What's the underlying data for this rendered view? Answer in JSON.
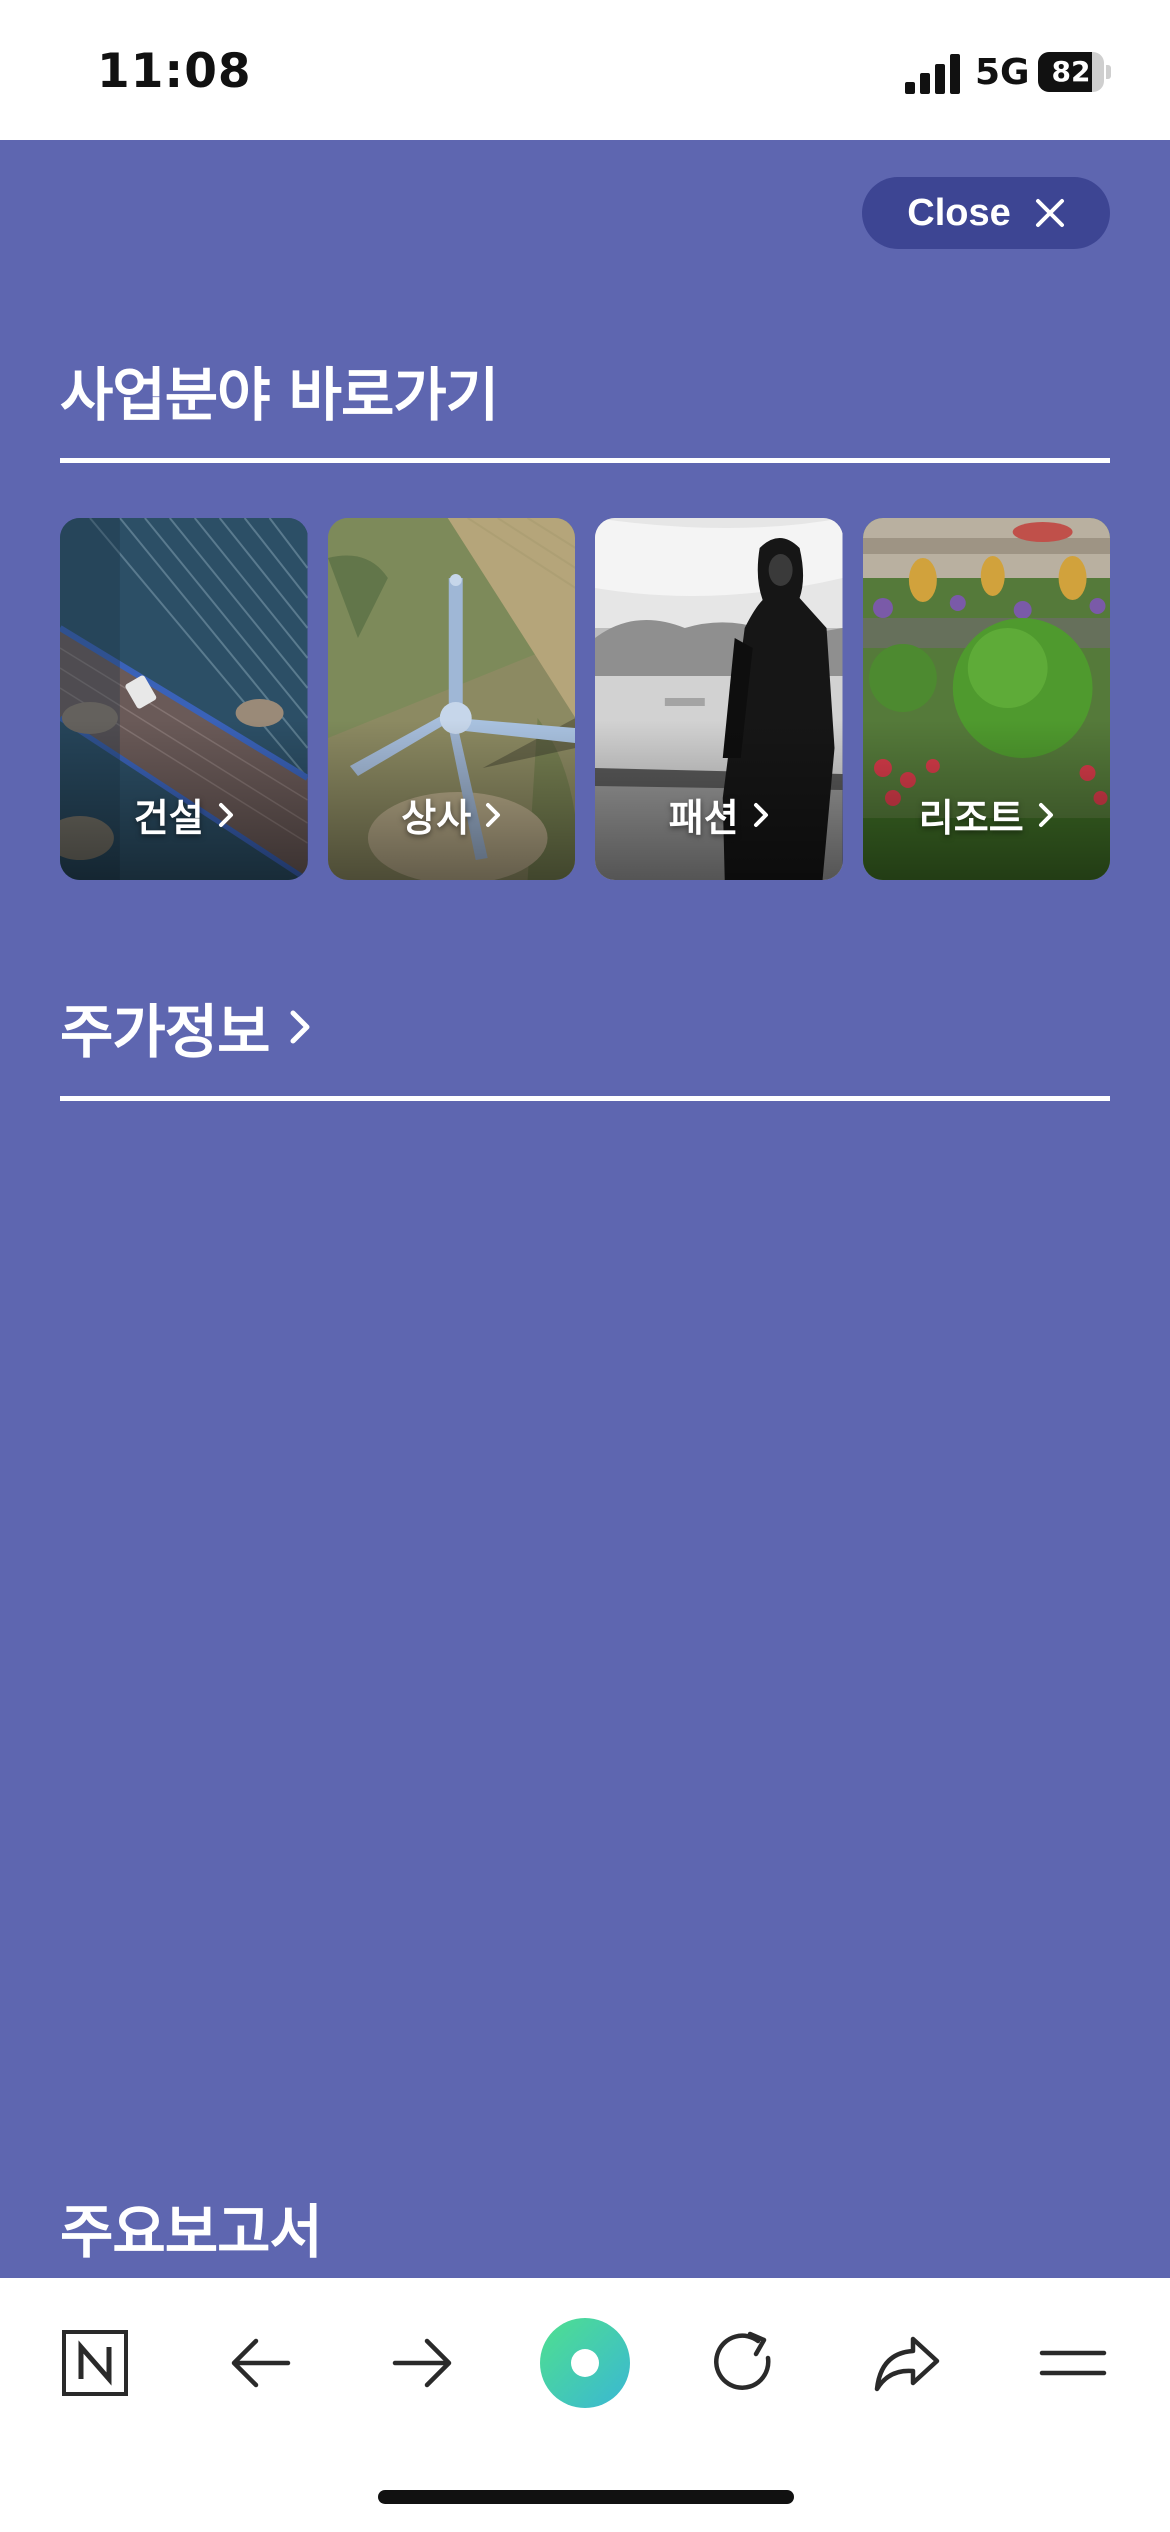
{
  "status_bar": {
    "time": "11:08",
    "network": "5G",
    "battery_level": "82",
    "battery_percent": 82
  },
  "menu": {
    "close_label": "Close",
    "business_section": {
      "title": "사업분야 바로가기",
      "cards": [
        {
          "label": "건설",
          "image": "bridge-photo"
        },
        {
          "label": "상사",
          "image": "wind-turbine-photo"
        },
        {
          "label": "패션",
          "image": "fashion-photo"
        },
        {
          "label": "리조트",
          "image": "resort-garden-photo"
        }
      ]
    },
    "stock_section": {
      "title": "주가정보"
    },
    "reports_section": {
      "title": "주요보고서"
    }
  },
  "toolbar": {
    "items": [
      {
        "icon": "naver-n-icon"
      },
      {
        "icon": "arrow-left-icon"
      },
      {
        "icon": "arrow-right-icon"
      },
      {
        "icon": "green-dot-icon"
      },
      {
        "icon": "refresh-icon"
      },
      {
        "icon": "share-icon"
      },
      {
        "icon": "menu-icon"
      }
    ]
  },
  "colors": {
    "panel_background": "#5e66b0",
    "close_button": "#3d4593",
    "text": "#ffffff",
    "toolbar_background": "#ffffff",
    "accent_green": "#4fd69c"
  }
}
